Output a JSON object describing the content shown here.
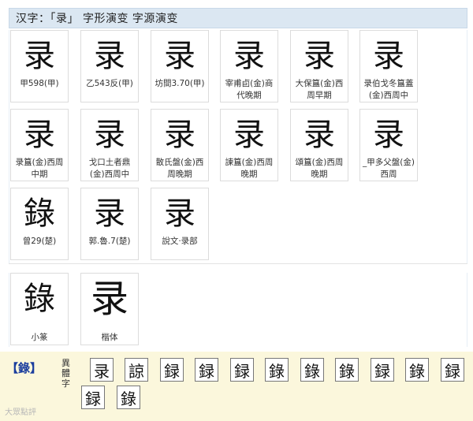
{
  "header": {
    "title": "汉字：「录」 字形演变 字源演变"
  },
  "cards": [
    {
      "glyph": "录",
      "caption": "甲598(甲)"
    },
    {
      "glyph": "录",
      "caption": "乙543反(甲)"
    },
    {
      "glyph": "录",
      "caption": "坊間3.70(甲)"
    },
    {
      "glyph": "录",
      "caption": "宰甫卣(金)商代晚期"
    },
    {
      "glyph": "录",
      "caption": "大保簋(金)西周早期"
    },
    {
      "glyph": "录",
      "caption": "录伯戈冬簋蓋(金)西周中"
    },
    {
      "glyph": "录",
      "caption": "录簋(金)西周中期"
    },
    {
      "glyph": "录",
      "caption": "戈口土者鼎(金)西周中"
    },
    {
      "glyph": "录",
      "caption": "散氏盤(金)西周晚期"
    },
    {
      "glyph": "录",
      "caption": "諫簋(金)西周晚期"
    },
    {
      "glyph": "录",
      "caption": "頌簋(金)西周晚期"
    },
    {
      "glyph": "录",
      "caption": "_甲多父盤(金)西周"
    },
    {
      "glyph": "錄",
      "caption": "曾29(楚)"
    },
    {
      "glyph": "录",
      "caption": "郭.魯.7(楚)"
    },
    {
      "glyph": "录",
      "caption": "說文·录部"
    },
    {
      "glyph": "錄",
      "caption": "小篆"
    },
    {
      "glyph": "录",
      "caption": "楷体"
    }
  ],
  "footer": {
    "label": "【錄】",
    "variant_tag": "異體字",
    "variants": [
      "录",
      "諒",
      "録",
      "録",
      "録",
      "錄",
      "錄",
      "錄",
      "録",
      "錄",
      "録",
      "録",
      "錄"
    ]
  },
  "watermark": "大眾點評"
}
